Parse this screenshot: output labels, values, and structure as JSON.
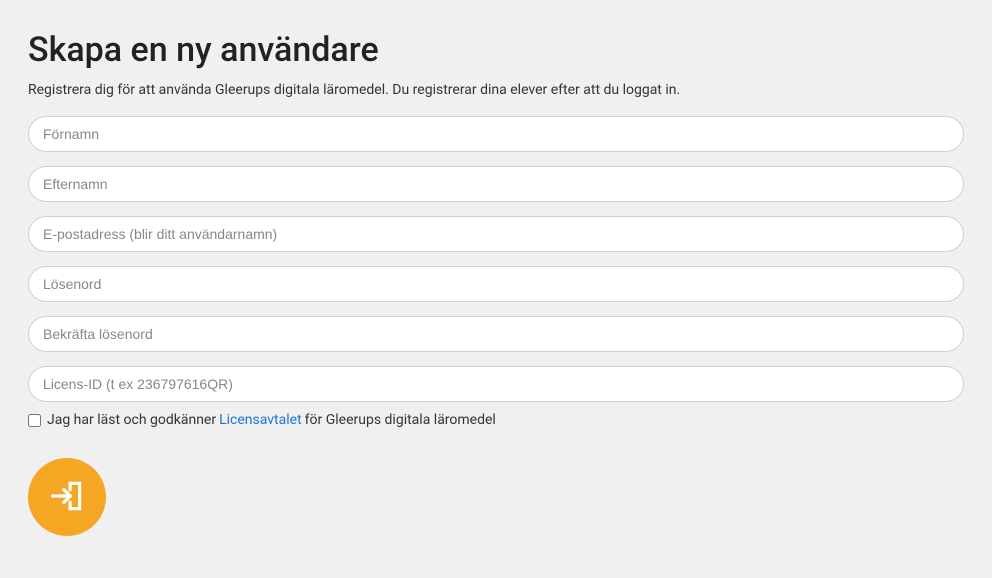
{
  "page": {
    "title": "Skapa en ny användare",
    "subtitle": "Registrera dig för att använda Gleerups digitala läromedel. Du registrerar dina elever efter att du loggat in."
  },
  "form": {
    "firstname_placeholder": "Förnamn",
    "lastname_placeholder": "Efternamn",
    "email_placeholder": "E-postadress (blir ditt användarnamn)",
    "password_placeholder": "Lösenord",
    "confirm_password_placeholder": "Bekräfta lösenord",
    "license_placeholder": "Licens-ID (t ex 236797616QR)"
  },
  "agreement": {
    "prefix": "Jag har läst och godkänner",
    "link_text": "Licensavtalet",
    "suffix": "för Gleerups digitala läromedel"
  }
}
